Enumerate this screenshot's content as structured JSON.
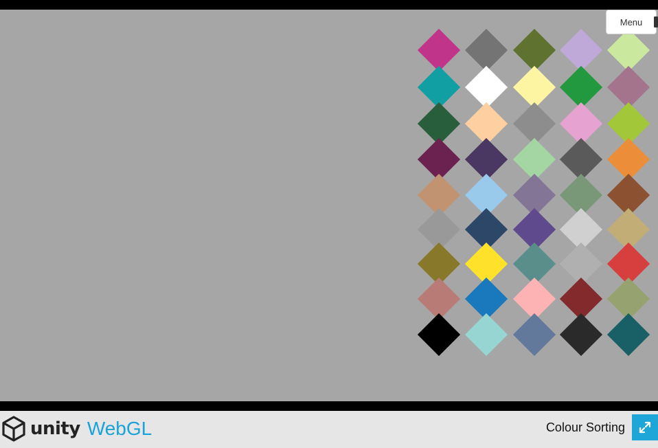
{
  "menu": {
    "label": "Menu"
  },
  "footer": {
    "logo_unity": "unity",
    "logo_webgl": "WebGL",
    "game_title": "Colour Sorting",
    "fullscreen_icon": "fullscreen-icon"
  },
  "board": {
    "rows": [
      [
        "#c0348a",
        "#747474",
        "#5f7230",
        "#bea9d9",
        "#cbe99e"
      ],
      [
        "#129fa3",
        "#ffffff",
        "#fef5a3",
        "#22983f",
        "#a4748d"
      ],
      [
        "#285e3b",
        "#fdcfa1",
        "#8d8d8d",
        "#e6a3d1",
        "#a2c83a"
      ],
      [
        "#6b2250",
        "#4a3762",
        "#a4d6a3",
        "#5a5a5a",
        "#ec8d3a"
      ],
      [
        "#c19370",
        "#99caec",
        "#837595",
        "#789878",
        "#8b5131"
      ],
      [
        "#999999",
        "#2d4768",
        "#5e4a8c",
        "#d0d0d0",
        "#c3ad76"
      ],
      [
        "#887829",
        "#fde12b",
        "#5a8e8a",
        "#b0b0b0",
        "#d73f3f"
      ],
      [
        "#b97b75",
        "#1a79bd",
        "#fdb3b3",
        "#822a2c",
        "#96a370"
      ],
      [
        "#000000",
        "#96d5d1",
        "#62799c",
        "#2a2a2a",
        "#186066"
      ]
    ]
  }
}
